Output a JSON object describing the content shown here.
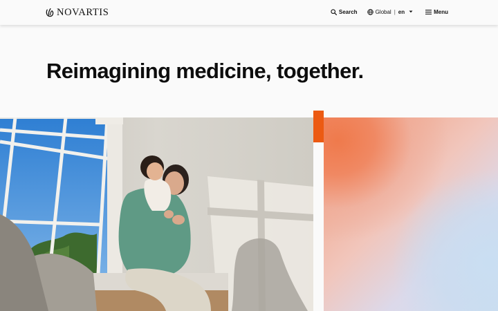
{
  "header": {
    "brand": "NOVARTIS",
    "nav": {
      "search_label": "Search",
      "region_label": "Global",
      "region_separator": "|",
      "language": "en",
      "menu_label": "Menu"
    }
  },
  "hero": {
    "headline_regular": "Reimagining medicine, ",
    "headline_bold": "together",
    "headline_end": "."
  },
  "colors": {
    "accent": "#ec5a12",
    "background": "#fafafa",
    "text": "#0d0d0d"
  }
}
